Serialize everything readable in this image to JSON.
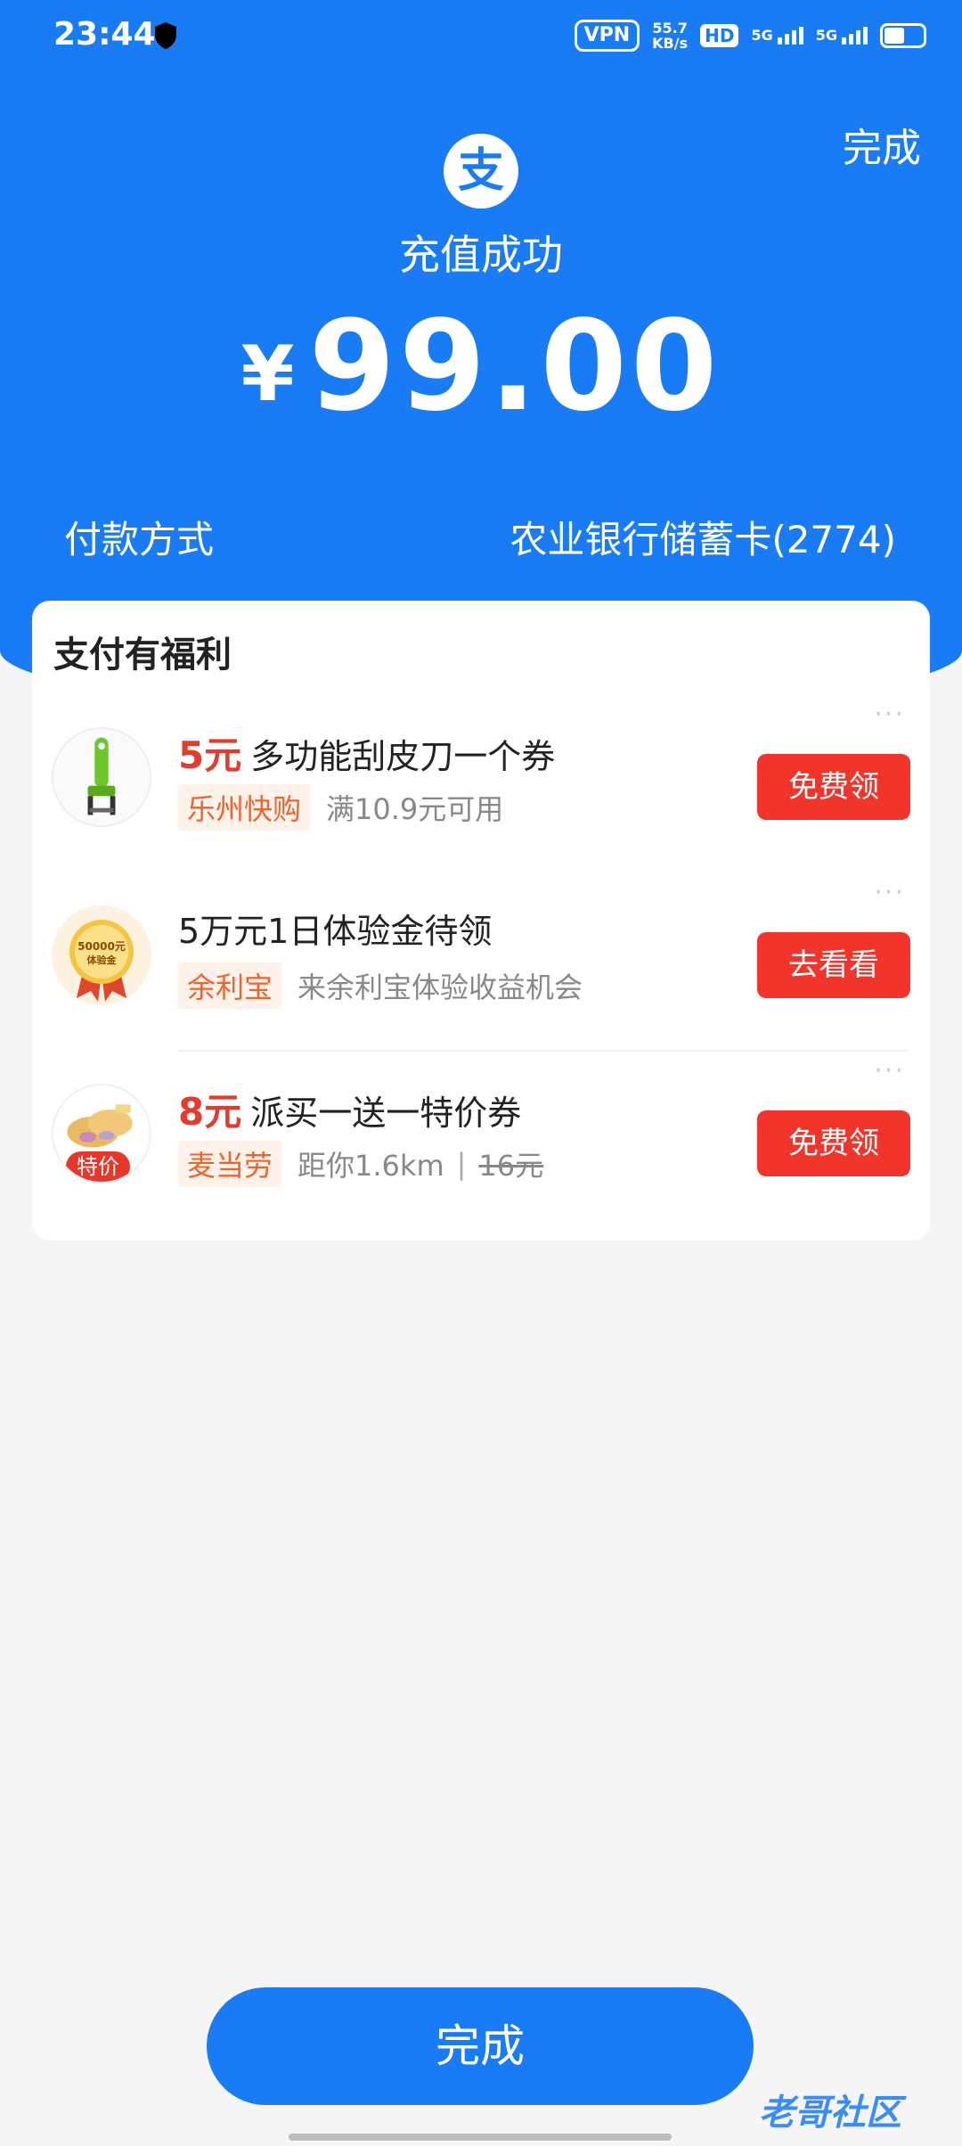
{
  "status_bar": {
    "time": "23:44",
    "vpn": "VPN",
    "speed_value": "55.7",
    "speed_unit": "KB/s",
    "hd": "HD",
    "network1": "5G",
    "network2": "5G"
  },
  "header": {
    "done_label": "完成",
    "logo_char": "支",
    "status_text": "充值成功",
    "currency": "¥",
    "amount": "99.00",
    "payment_method_label": "付款方式",
    "payment_method_value": "农业银行储蓄卡(2774)"
  },
  "benefits": {
    "title": "支付有福利",
    "more": "···",
    "offers": [
      {
        "price": "5元",
        "title": "多功能刮皮刀一个券",
        "tag": "乐州快购",
        "desc": "满10.9元可用",
        "button": "免费领"
      },
      {
        "title": "5万元1日体验金待领",
        "badge_line1": "50000元",
        "badge_line2": "体验金",
        "tag": "余利宝",
        "desc": "来余利宝体验收益机会",
        "button": "去看看"
      },
      {
        "price": "8元",
        "title": "派买一送一特价券",
        "thumb_badge": "特价",
        "tag": "麦当劳",
        "desc": "距你1.6km",
        "separator": "|",
        "old_price": "16元",
        "button": "免费领"
      }
    ]
  },
  "footer": {
    "done_label": "完成",
    "watermark": "老哥社区"
  },
  "colors": {
    "primary": "#1a7cf4",
    "button_red": "#f2352a",
    "price_red": "#e53b2c",
    "tag_orange": "#f0632a"
  }
}
